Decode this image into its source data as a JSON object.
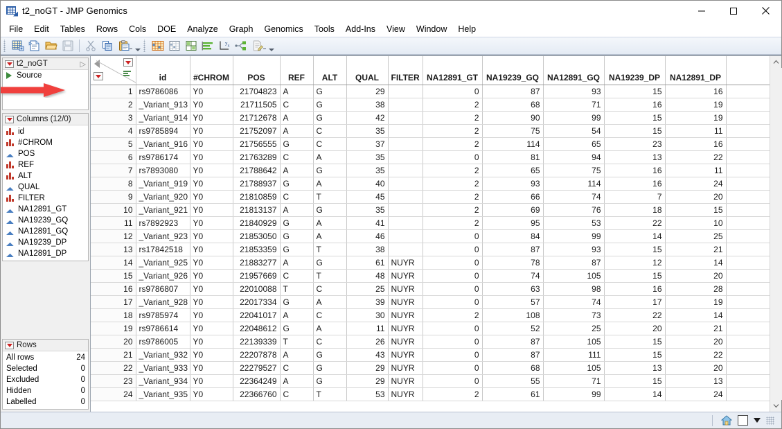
{
  "window": {
    "title": "t2_noGT - JMP Genomics",
    "icon": "jmp-table-icon",
    "minimize": "—",
    "maximize": "□",
    "close": "✕"
  },
  "menubar": {
    "items": [
      "File",
      "Edit",
      "Tables",
      "Rows",
      "Cols",
      "DOE",
      "Analyze",
      "Graph",
      "Genomics",
      "Tools",
      "Add-Ins",
      "View",
      "Window",
      "Help"
    ]
  },
  "toolbar": {
    "group1": [
      "new-data-table-icon",
      "new-script-icon",
      "open-file-icon",
      "save-icon",
      "cut-icon",
      "copy-icon",
      "paste-icon"
    ],
    "group2": [
      "distribution-icon",
      "fit-y-by-x-icon",
      "matched-pairs-icon",
      "bar-chart-icon",
      "fit-model-icon",
      "partition-icon",
      "script-editor-icon"
    ]
  },
  "sidebar": {
    "source_panel": {
      "title": "t2_noGT",
      "expand_icon": "expand-triangle-icon",
      "menu_icon": "red-triangle-menu-icon",
      "items": [
        {
          "label": "Source",
          "icon": "green-run-triangle-icon"
        }
      ]
    },
    "columns_panel": {
      "title": "Columns (12/0)",
      "menu_icon": "red-triangle-menu-icon",
      "items": [
        {
          "label": "id",
          "type": "nominal"
        },
        {
          "label": "#CHROM",
          "type": "nominal"
        },
        {
          "label": "POS",
          "type": "continuous"
        },
        {
          "label": "REF",
          "type": "nominal"
        },
        {
          "label": "ALT",
          "type": "nominal"
        },
        {
          "label": "QUAL",
          "type": "continuous"
        },
        {
          "label": "FILTER",
          "type": "nominal"
        },
        {
          "label": "NA12891_GT",
          "type": "continuous"
        },
        {
          "label": "NA19239_GQ",
          "type": "continuous"
        },
        {
          "label": "NA12891_GQ",
          "type": "continuous"
        },
        {
          "label": "NA19239_DP",
          "type": "continuous"
        },
        {
          "label": "NA12891_DP",
          "type": "continuous"
        }
      ]
    },
    "rows_panel": {
      "title": "Rows",
      "menu_icon": "red-triangle-menu-icon",
      "stats": [
        {
          "label": "All rows",
          "value": "24"
        },
        {
          "label": "Selected",
          "value": "0"
        },
        {
          "label": "Excluded",
          "value": "0"
        },
        {
          "label": "Hidden",
          "value": "0"
        },
        {
          "label": "Labelled",
          "value": "0"
        }
      ]
    }
  },
  "table": {
    "columns": [
      "id",
      "#CHROM",
      "POS",
      "REF",
      "ALT",
      "QUAL",
      "FILTER",
      "NA12891_GT",
      "NA19239_GQ",
      "NA12891_GQ",
      "NA19239_DP",
      "NA12891_DP"
    ],
    "column_align": [
      "txt",
      "txt",
      "num",
      "txt",
      "txt",
      "num",
      "txt",
      "num",
      "num",
      "num",
      "num",
      "num"
    ],
    "rows": [
      {
        "n": "1",
        "cells": [
          "rs9786086",
          "Y0",
          "21704823",
          "A",
          "G",
          "29",
          "",
          "0",
          "87",
          "93",
          "15",
          "16"
        ]
      },
      {
        "n": "2",
        "cells": [
          "_Variant_913",
          "Y0",
          "21711505",
          "C",
          "G",
          "38",
          "",
          "2",
          "68",
          "71",
          "16",
          "19"
        ]
      },
      {
        "n": "3",
        "cells": [
          "_Variant_914",
          "Y0",
          "21712678",
          "A",
          "G",
          "42",
          "",
          "2",
          "90",
          "99",
          "15",
          "19"
        ]
      },
      {
        "n": "4",
        "cells": [
          "rs9785894",
          "Y0",
          "21752097",
          "A",
          "C",
          "35",
          "",
          "2",
          "75",
          "54",
          "15",
          "11"
        ]
      },
      {
        "n": "5",
        "cells": [
          "_Variant_916",
          "Y0",
          "21756555",
          "G",
          "C",
          "37",
          "",
          "2",
          "114",
          "65",
          "23",
          "16"
        ]
      },
      {
        "n": "6",
        "cells": [
          "rs9786174",
          "Y0",
          "21763289",
          "C",
          "A",
          "35",
          "",
          "0",
          "81",
          "94",
          "13",
          "22"
        ]
      },
      {
        "n": "7",
        "cells": [
          "rs7893080",
          "Y0",
          "21788642",
          "A",
          "G",
          "35",
          "",
          "2",
          "65",
          "75",
          "16",
          "11"
        ]
      },
      {
        "n": "8",
        "cells": [
          "_Variant_919",
          "Y0",
          "21788937",
          "G",
          "A",
          "40",
          "",
          "2",
          "93",
          "114",
          "16",
          "24"
        ]
      },
      {
        "n": "9",
        "cells": [
          "_Variant_920",
          "Y0",
          "21810859",
          "C",
          "T",
          "45",
          "",
          "2",
          "66",
          "74",
          "7",
          "20"
        ]
      },
      {
        "n": "10",
        "cells": [
          "_Variant_921",
          "Y0",
          "21813137",
          "A",
          "G",
          "35",
          "",
          "2",
          "69",
          "76",
          "18",
          "15"
        ]
      },
      {
        "n": "11",
        "cells": [
          "rs7892923",
          "Y0",
          "21840929",
          "G",
          "A",
          "41",
          "",
          "2",
          "95",
          "53",
          "22",
          "10"
        ]
      },
      {
        "n": "12",
        "cells": [
          "_Variant_923",
          "Y0",
          "21853050",
          "G",
          "A",
          "46",
          "",
          "0",
          "84",
          "99",
          "14",
          "25"
        ]
      },
      {
        "n": "13",
        "cells": [
          "rs17842518",
          "Y0",
          "21853359",
          "G",
          "T",
          "38",
          "",
          "0",
          "87",
          "93",
          "15",
          "21"
        ]
      },
      {
        "n": "14",
        "cells": [
          "_Variant_925",
          "Y0",
          "21883277",
          "A",
          "G",
          "61",
          "NUYR",
          "0",
          "78",
          "87",
          "12",
          "14"
        ]
      },
      {
        "n": "15",
        "cells": [
          "_Variant_926",
          "Y0",
          "21957669",
          "C",
          "T",
          "48",
          "NUYR",
          "0",
          "74",
          "105",
          "15",
          "20"
        ]
      },
      {
        "n": "16",
        "cells": [
          "rs9786807",
          "Y0",
          "22010088",
          "T",
          "C",
          "25",
          "NUYR",
          "0",
          "63",
          "98",
          "16",
          "28"
        ]
      },
      {
        "n": "17",
        "cells": [
          "_Variant_928",
          "Y0",
          "22017334",
          "G",
          "A",
          "39",
          "NUYR",
          "0",
          "57",
          "74",
          "17",
          "19"
        ]
      },
      {
        "n": "18",
        "cells": [
          "rs9785974",
          "Y0",
          "22041017",
          "A",
          "C",
          "30",
          "NUYR",
          "2",
          "108",
          "73",
          "22",
          "14"
        ]
      },
      {
        "n": "19",
        "cells": [
          "rs9786614",
          "Y0",
          "22048612",
          "G",
          "A",
          "11",
          "NUYR",
          "0",
          "52",
          "25",
          "20",
          "21"
        ]
      },
      {
        "n": "20",
        "cells": [
          "rs9786005",
          "Y0",
          "22139339",
          "T",
          "C",
          "26",
          "NUYR",
          "0",
          "87",
          "105",
          "15",
          "20"
        ]
      },
      {
        "n": "21",
        "cells": [
          "_Variant_932",
          "Y0",
          "22207878",
          "A",
          "G",
          "43",
          "NUYR",
          "0",
          "87",
          "111",
          "15",
          "22"
        ]
      },
      {
        "n": "22",
        "cells": [
          "_Variant_933",
          "Y0",
          "22279527",
          "C",
          "G",
          "29",
          "NUYR",
          "0",
          "68",
          "105",
          "13",
          "20"
        ]
      },
      {
        "n": "23",
        "cells": [
          "_Variant_934",
          "Y0",
          "22364249",
          "A",
          "G",
          "29",
          "NUYR",
          "0",
          "55",
          "71",
          "15",
          "13"
        ]
      },
      {
        "n": "24",
        "cells": [
          "_Variant_935",
          "Y0",
          "22366760",
          "C",
          "T",
          "53",
          "NUYR",
          "2",
          "61",
          "99",
          "14",
          "24"
        ]
      }
    ]
  },
  "annotation": {
    "arrow": "red-arrow-pointing-to-row-1",
    "color": "#f03c3c"
  },
  "statusbar": {
    "home_icon": "home-icon",
    "square_icon": "white-square-icon",
    "dropdown_icon": "black-triangle-down-icon",
    "grip_icon": "resize-grip-icon"
  },
  "scrollbar": {
    "up_icon": "chevron-up-icon",
    "down_icon": "chevron-down-icon"
  }
}
